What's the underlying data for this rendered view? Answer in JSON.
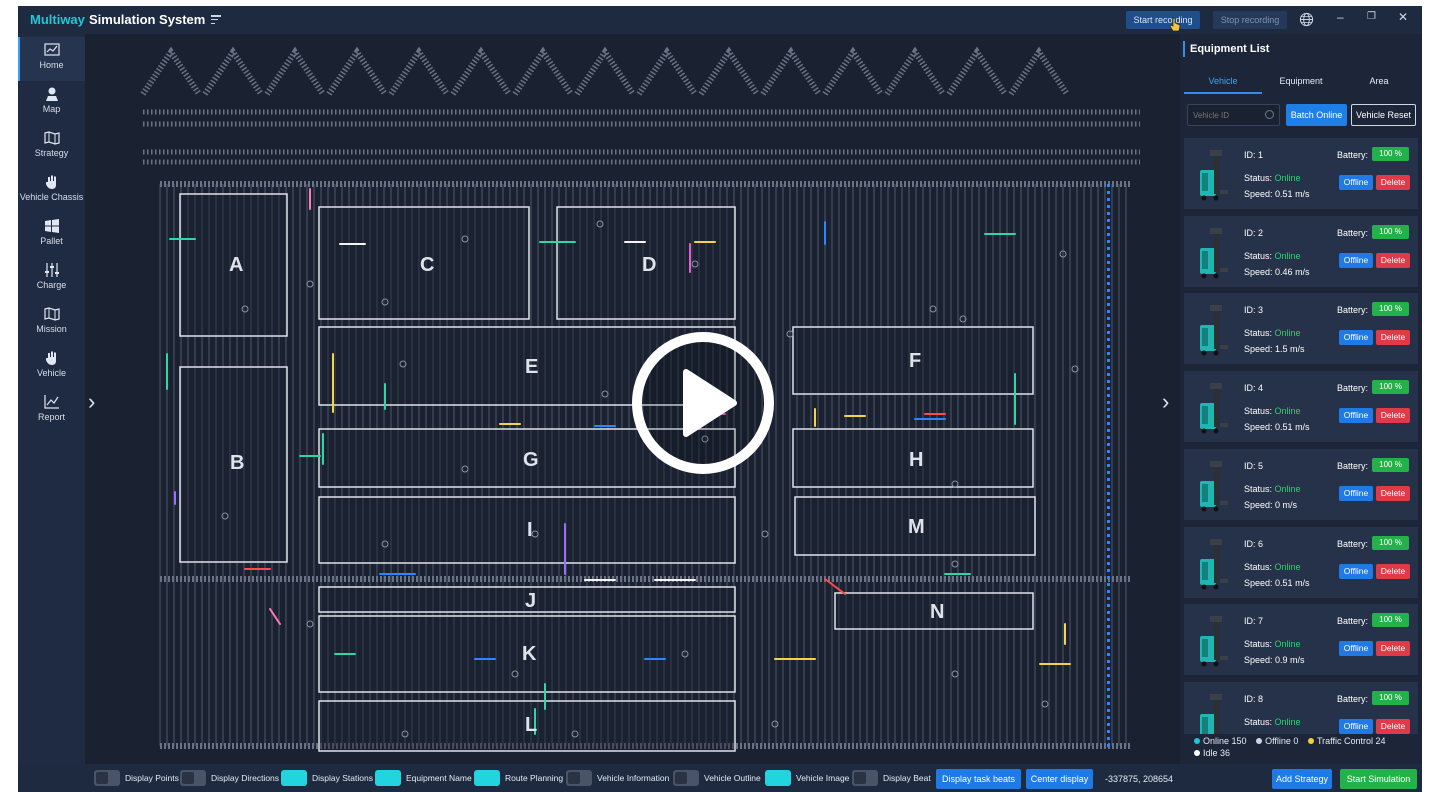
{
  "app": {
    "brand": "Multiway",
    "title": "Simulation System",
    "start_recording": "Start recording",
    "stop_recording": "Stop recording"
  },
  "nav": [
    {
      "label": "Home",
      "icon": "chart-icon"
    },
    {
      "label": "Map",
      "icon": "map-pin-icon"
    },
    {
      "label": "Strategy",
      "icon": "map-fold-icon"
    },
    {
      "label": "Vehicle Chassis",
      "icon": "hand-icon"
    },
    {
      "label": "Pallet",
      "icon": "windows-grid-icon"
    },
    {
      "label": "Charge",
      "icon": "sliders-icon"
    },
    {
      "label": "Mission",
      "icon": "map-fold-icon"
    },
    {
      "label": "Vehicle",
      "icon": "hand-icon"
    },
    {
      "label": "Report",
      "icon": "line-chart-icon"
    }
  ],
  "map": {
    "zones": [
      "A",
      "B",
      "C",
      "D",
      "E",
      "F",
      "G",
      "H",
      "I",
      "M",
      "J",
      "N",
      "K",
      "L"
    ]
  },
  "panel": {
    "title": "Equipment List",
    "tabs": [
      "Vehicle",
      "Equipment",
      "Area"
    ],
    "search_placeholder": "Vehicle ID",
    "batch_online": "Batch Online",
    "vehicle_reset": "Vehicle Reset",
    "id_label": "ID:",
    "status_label": "Status:",
    "speed_label": "Speed:",
    "battery_label": "Battery:",
    "offline_btn": "Offline",
    "delete_btn": "Delete",
    "vehicles": [
      {
        "id": "1",
        "status": "Online",
        "speed": "0.51 m/s",
        "battery": "100 %"
      },
      {
        "id": "2",
        "status": "Online",
        "speed": "0.46 m/s",
        "battery": "100 %"
      },
      {
        "id": "3",
        "status": "Online",
        "speed": "1.5 m/s",
        "battery": "100 %"
      },
      {
        "id": "4",
        "status": "Online",
        "speed": "0.51 m/s",
        "battery": "100 %"
      },
      {
        "id": "5",
        "status": "Online",
        "speed": "0 m/s",
        "battery": "100 %"
      },
      {
        "id": "6",
        "status": "Online",
        "speed": "0.51 m/s",
        "battery": "100 %"
      },
      {
        "id": "7",
        "status": "Online",
        "speed": "0.9 m/s",
        "battery": "100 %"
      },
      {
        "id": "8",
        "status": "Online",
        "speed": "",
        "battery": "100 %"
      }
    ],
    "legend": [
      {
        "label": "Online 150",
        "color": "#22c4d8"
      },
      {
        "label": "Offline 0",
        "color": "#cfd6e0"
      },
      {
        "label": "Traffic Control 24",
        "color": "#f1d330"
      },
      {
        "label": "Idle 36",
        "color": "#ffffff"
      }
    ]
  },
  "bottom": {
    "toggles": [
      {
        "label": "Display Points",
        "on": false
      },
      {
        "label": "Display Directions",
        "on": false
      },
      {
        "label": "Display Stations",
        "on": true
      },
      {
        "label": "Equipment Name",
        "on": true
      },
      {
        "label": "Route Planning",
        "on": true
      },
      {
        "label": "Vehicle Information",
        "on": false
      },
      {
        "label": "Vehicle Outline",
        "on": false
      },
      {
        "label": "Vehicle Image",
        "on": true
      },
      {
        "label": "Display Beat",
        "on": false
      }
    ],
    "display_task_beats": "Display task beats",
    "center_display": "Center display",
    "coords": "-337875, 208654",
    "add_strategy": "Add Strategy",
    "start_simulation": "Start Simulation"
  }
}
